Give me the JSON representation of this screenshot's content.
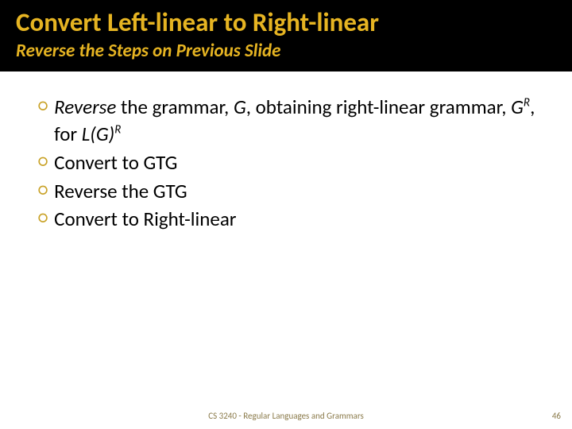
{
  "header": {
    "title": "Convert Left-linear to Right-linear",
    "subtitle": "Reverse the Steps on Previous Slide"
  },
  "bullets": {
    "b0_pre": "Reverse",
    "b0_mid1": " the grammar, ",
    "b0_g": "G",
    "b0_mid2": ", obtaining right-linear grammar, ",
    "b0_gr": "G",
    "b0_sup1": "R",
    "b0_mid3": ", for ",
    "b0_lg": "L(G)",
    "b0_sup2": "R",
    "b1": "Convert to GTG",
    "b2": "Reverse the GTG",
    "b3": "Convert to Right-linear"
  },
  "footer": {
    "note": "CS 3240 - Regular Languages and Grammars",
    "page": "46"
  }
}
